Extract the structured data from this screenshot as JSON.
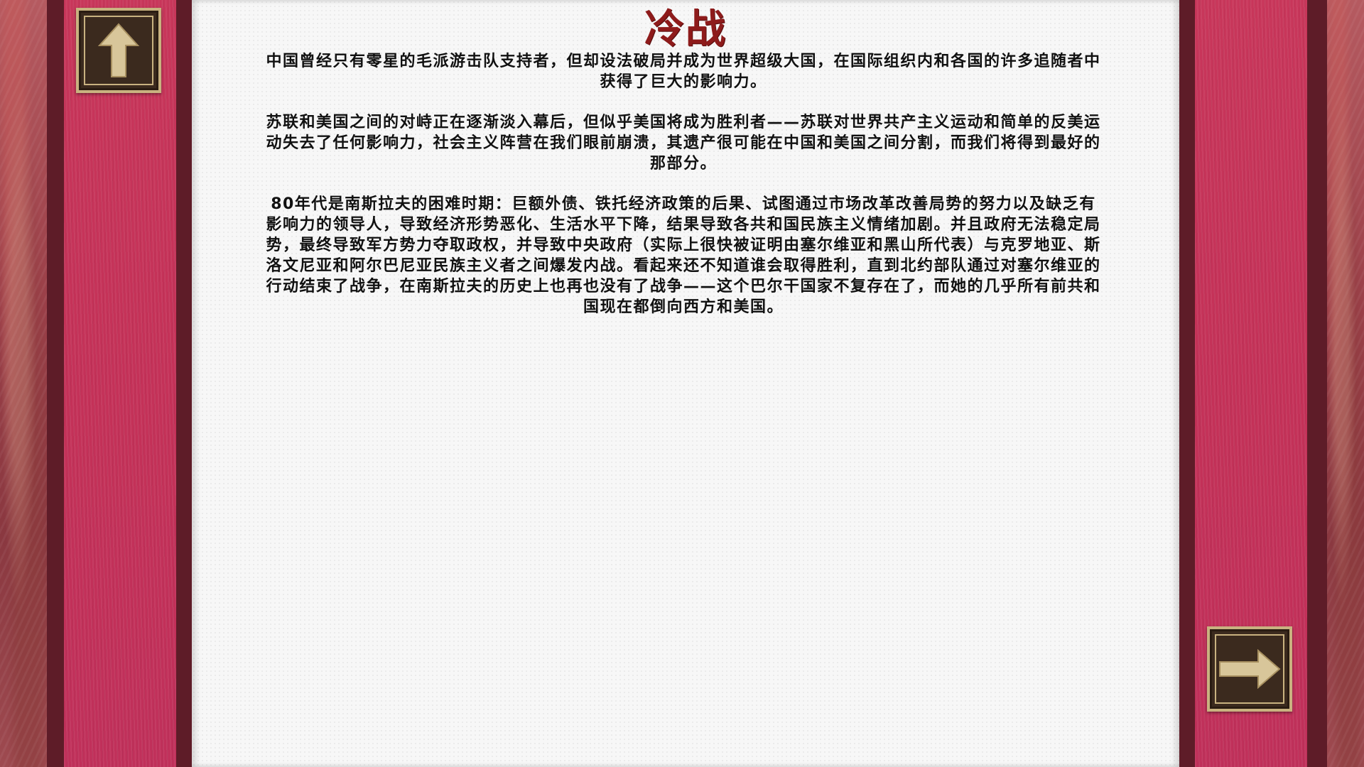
{
  "page": {
    "title": "冷战",
    "paragraphs": [
      "中国曾经只有零星的毛派游击队支持者，但却设法破局并成为世界超级大国，在国际组织内和各国的许多追随者中获得了巨大的影响力。",
      "苏联和美国之间的对峙正在逐渐淡入幕后，但似乎美国将成为胜利者——苏联对世界共产主义运动和简单的反美运动失去了任何影响力，社会主义阵营在我们眼前崩溃，其遗产很可能在中国和美国之间分割，而我们将得到最好的那部分。",
      "80年代是南斯拉夫的困难时期：巨额外债、铁托经济政策的后果、试图通过市场改革改善局势的努力以及缺乏有影响力的领导人，导致经济形势恶化、生活水平下降，结果导致各共和国民族主义情绪加剧。并且政府无法稳定局势，最终导致军方势力夺取政权，并导致中央政府（实际上很快被证明由塞尔维亚和黑山所代表）与克罗地亚、斯洛文尼亚和阿尔巴尼亚民族主义者之间爆发内战。看起来还不知道谁会取得胜利，直到北约部队通过对塞尔维亚的行动结束了战争，在南斯拉夫的历史上也再也没有了战争——这个巴尔干国家不复存在了，而她的几乎所有前共和国现在都倒向西方和美国。"
    ]
  },
  "nav": {
    "up_icon": "arrow-up-icon",
    "next_icon": "arrow-right-icon"
  },
  "colors": {
    "title": "#8e1b1b",
    "panel": "#c43158",
    "frame": "#5e1c28",
    "button_gold": "#c9b280",
    "button_dark": "#3b2a1e"
  }
}
